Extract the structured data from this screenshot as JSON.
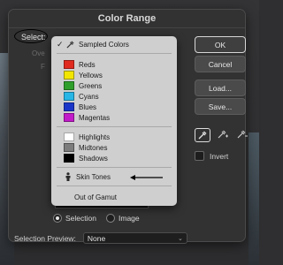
{
  "dialog": {
    "title": "Color Range",
    "select_label": "Select:",
    "dimmed": [
      "Ove",
      "F"
    ],
    "buttons": {
      "ok": "OK",
      "cancel": "Cancel",
      "load": "Load...",
      "save": "Save..."
    },
    "invert_label": "Invert",
    "view_options": {
      "selection": "Selection",
      "image": "Image",
      "selected": "selection"
    },
    "selection_preview": {
      "label": "Selection Preview:",
      "value": "None"
    }
  },
  "menu": {
    "sampled_colors": "Sampled Colors",
    "colors": [
      {
        "label": "Reds",
        "color": "#e02a1f"
      },
      {
        "label": "Yellows",
        "color": "#f2e600"
      },
      {
        "label": "Greens",
        "color": "#2f9f2b"
      },
      {
        "label": "Cyans",
        "color": "#27b6e6"
      },
      {
        "label": "Blues",
        "color": "#1a36c9"
      },
      {
        "label": "Magentas",
        "color": "#c21bc9"
      }
    ],
    "tones": [
      {
        "label": "Highlights",
        "color": "#ffffff"
      },
      {
        "label": "Midtones",
        "color": "#7c7c7c"
      },
      {
        "label": "Shadows",
        "color": "#000000"
      }
    ],
    "skin_tones": "Skin Tones",
    "out_of_gamut": "Out of Gamut"
  },
  "icons": {
    "check": "checkmark-icon",
    "eyedropper": "eyedropper-icon",
    "person": "person-icon",
    "arrow": "arrow-left-icon"
  }
}
